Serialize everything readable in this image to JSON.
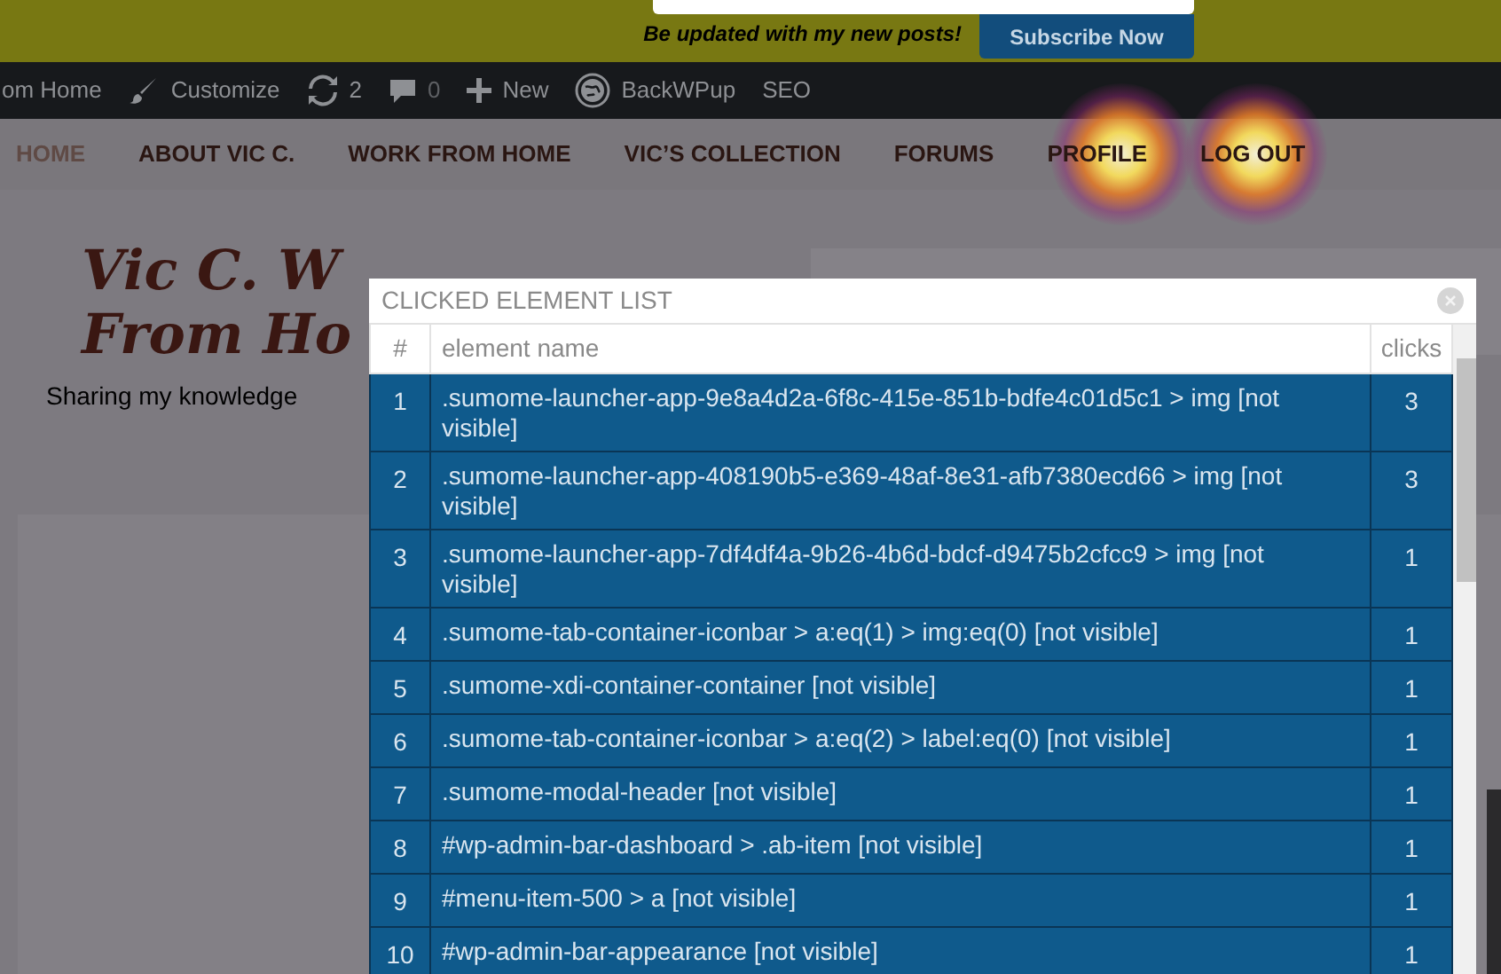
{
  "promo_bar": {
    "message": "Be updated with my new posts!",
    "button": "Subscribe Now"
  },
  "admin_bar": {
    "items": [
      {
        "kind": "text",
        "label": "om Home"
      },
      {
        "kind": "customize",
        "label": "Customize"
      },
      {
        "kind": "updates",
        "label": "2"
      },
      {
        "kind": "comments",
        "label": "0"
      },
      {
        "kind": "new",
        "label": "New"
      },
      {
        "kind": "backwpup",
        "label": "BackWPup"
      },
      {
        "kind": "text",
        "label": "SEO"
      }
    ]
  },
  "nav": [
    {
      "label": "HOME",
      "selected": true
    },
    {
      "label": "ABOUT VIC C.",
      "selected": false
    },
    {
      "label": "WORK FROM HOME",
      "selected": false
    },
    {
      "label": "VIC’S COLLECTION",
      "selected": false
    },
    {
      "label": "FORUMS",
      "selected": false
    },
    {
      "label": "PROFILE",
      "selected": false
    },
    {
      "label": "LOG OUT",
      "selected": false
    }
  ],
  "site": {
    "title_lines": [
      "Vic C. W",
      "From Ho"
    ],
    "tagline": "Sharing my knowledge"
  },
  "modal": {
    "title": "CLICKED ELEMENT LIST",
    "columns": [
      "#",
      "element name",
      "clicks"
    ],
    "rows": [
      {
        "index": "1",
        "name": ".sumome-launcher-app-9e8a4d2a-6f8c-415e-851b-bdfe4c01d5c1 > img [not visible]",
        "clicks": "3"
      },
      {
        "index": "2",
        "name": ".sumome-launcher-app-408190b5-e369-48af-8e31-afb7380ecd66 > img [not visible]",
        "clicks": "3"
      },
      {
        "index": "3",
        "name": ".sumome-launcher-app-7df4df4a-9b26-4b6d-bdcf-d9475b2cfcc9 > img [not visible]",
        "clicks": "1"
      },
      {
        "index": "4",
        "name": ".sumome-tab-container-iconbar > a:eq(1) > img:eq(0) [not visible]",
        "clicks": "1"
      },
      {
        "index": "5",
        "name": ".sumome-xdi-container-container [not visible]",
        "clicks": "1"
      },
      {
        "index": "6",
        "name": ".sumome-tab-container-iconbar > a:eq(2) > label:eq(0) [not visible]",
        "clicks": "1"
      },
      {
        "index": "7",
        "name": ".sumome-modal-header [not visible]",
        "clicks": "1"
      },
      {
        "index": "8",
        "name": "#wp-admin-bar-dashboard > .ab-item [not visible]",
        "clicks": "1"
      },
      {
        "index": "9",
        "name": "#menu-item-500 > a [not visible]",
        "clicks": "1"
      },
      {
        "index": "10",
        "name": "#wp-admin-bar-appearance [not visible]",
        "clicks": "1"
      }
    ]
  }
}
